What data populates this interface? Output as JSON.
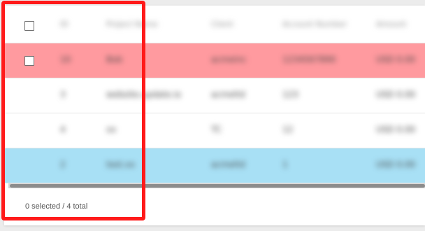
{
  "table": {
    "header": {
      "id": "ID",
      "name": "Project Name",
      "client": "Client",
      "account_number": "Account Number",
      "amount": "Amount"
    },
    "rows": [
      {
        "highlight": "red",
        "id": "10",
        "name": "Bob",
        "client": "acmeinc",
        "account_number": "1234567890",
        "amount": "USD 0.00"
      },
      {
        "highlight": "none",
        "id": "3",
        "name": "website.update.io",
        "client": "acmeltd",
        "account_number": "123",
        "amount": "USD 0.00"
      },
      {
        "highlight": "none",
        "id": "4",
        "name": "xx",
        "client": "TC",
        "account_number": "12",
        "amount": "USD 0.00"
      },
      {
        "highlight": "blue",
        "id": "2",
        "name": "test.xx",
        "client": "acmeltd",
        "account_number": "1",
        "amount": "USD 0.00"
      }
    ]
  },
  "footer": {
    "selection_summary": "0 selected / 4 total"
  },
  "colors": {
    "row_error": "#ff9a9f",
    "row_info": "#a8e0f5",
    "focus_outline": "#ff1a1a"
  }
}
